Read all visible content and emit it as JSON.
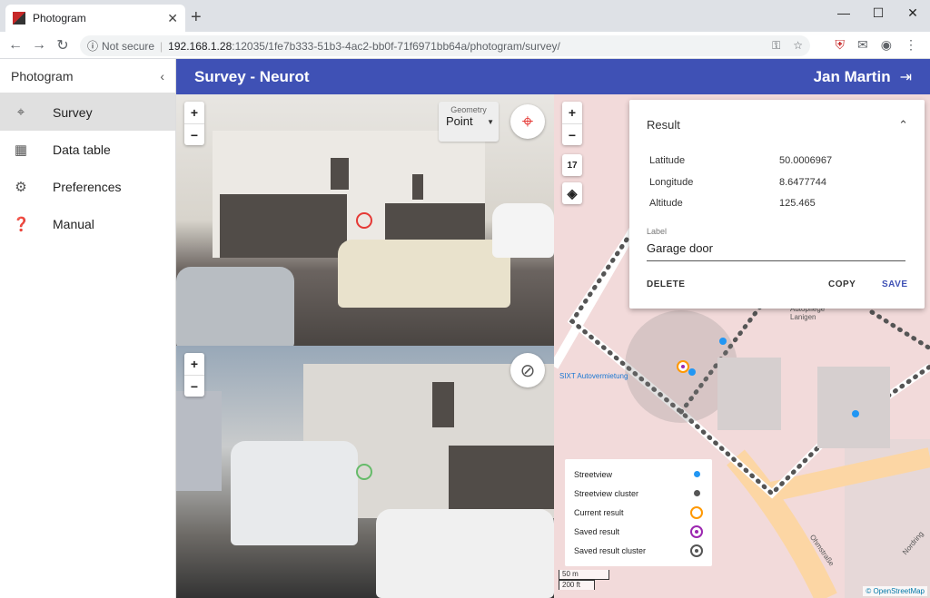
{
  "browser": {
    "tab_title": "Photogram",
    "tab_close": "✕",
    "new_tab": "+",
    "security": "Not secure",
    "url_host": "192.168.1.28",
    "url_path": ":12035/1fe7b333-51b3-4ac2-bb0f-71f6971bb64a/photogram/survey/"
  },
  "sidebar": {
    "title": "Photogram",
    "items": [
      {
        "label": "Survey",
        "icon": "crosshair-icon",
        "active": true
      },
      {
        "label": "Data table",
        "icon": "table-icon",
        "active": false
      },
      {
        "label": "Preferences",
        "icon": "gear-icon",
        "active": false
      },
      {
        "label": "Manual",
        "icon": "help-icon",
        "active": false
      }
    ]
  },
  "appbar": {
    "title": "Survey - Neurot",
    "user": "Jan Martin"
  },
  "photo_top": {
    "zoom_in": "+",
    "zoom_out": "−",
    "geometry_label": "Geometry",
    "geometry_value": "Point"
  },
  "photo_bottom": {
    "zoom_in": "+",
    "zoom_out": "−"
  },
  "map": {
    "zoom_in": "+",
    "zoom_out": "−",
    "zoom_level": "17",
    "labels": {
      "sixt": "SIXT Autovermietung",
      "autopflege": "Autopflege Lanigen",
      "ohmstrasse": "Ohmstraße",
      "nordring": "Nordring"
    },
    "scale_m": "50 m",
    "scale_ft": "200 ft",
    "attribution": "© OpenStreetMap"
  },
  "result": {
    "title": "Result",
    "rows": [
      {
        "key": "Latitude",
        "value": "50.0006967"
      },
      {
        "key": "Longitude",
        "value": "8.6477744"
      },
      {
        "key": "Altitude",
        "value": "125.465"
      }
    ],
    "label_caption": "Label",
    "label_value": "Garage door",
    "delete": "DELETE",
    "copy": "COPY",
    "save": "SAVE"
  },
  "legend": [
    {
      "label": "Streetview",
      "color": "#2196f3"
    },
    {
      "label": "Streetview cluster",
      "color": "#555555"
    },
    {
      "label": "Current result",
      "color": "#ff9800"
    },
    {
      "label": "Saved result",
      "color": "#9c27b0"
    },
    {
      "label": "Saved result cluster",
      "color": "#555555"
    }
  ],
  "colors": {
    "accent": "#3f51b5",
    "target": "#e53935"
  }
}
